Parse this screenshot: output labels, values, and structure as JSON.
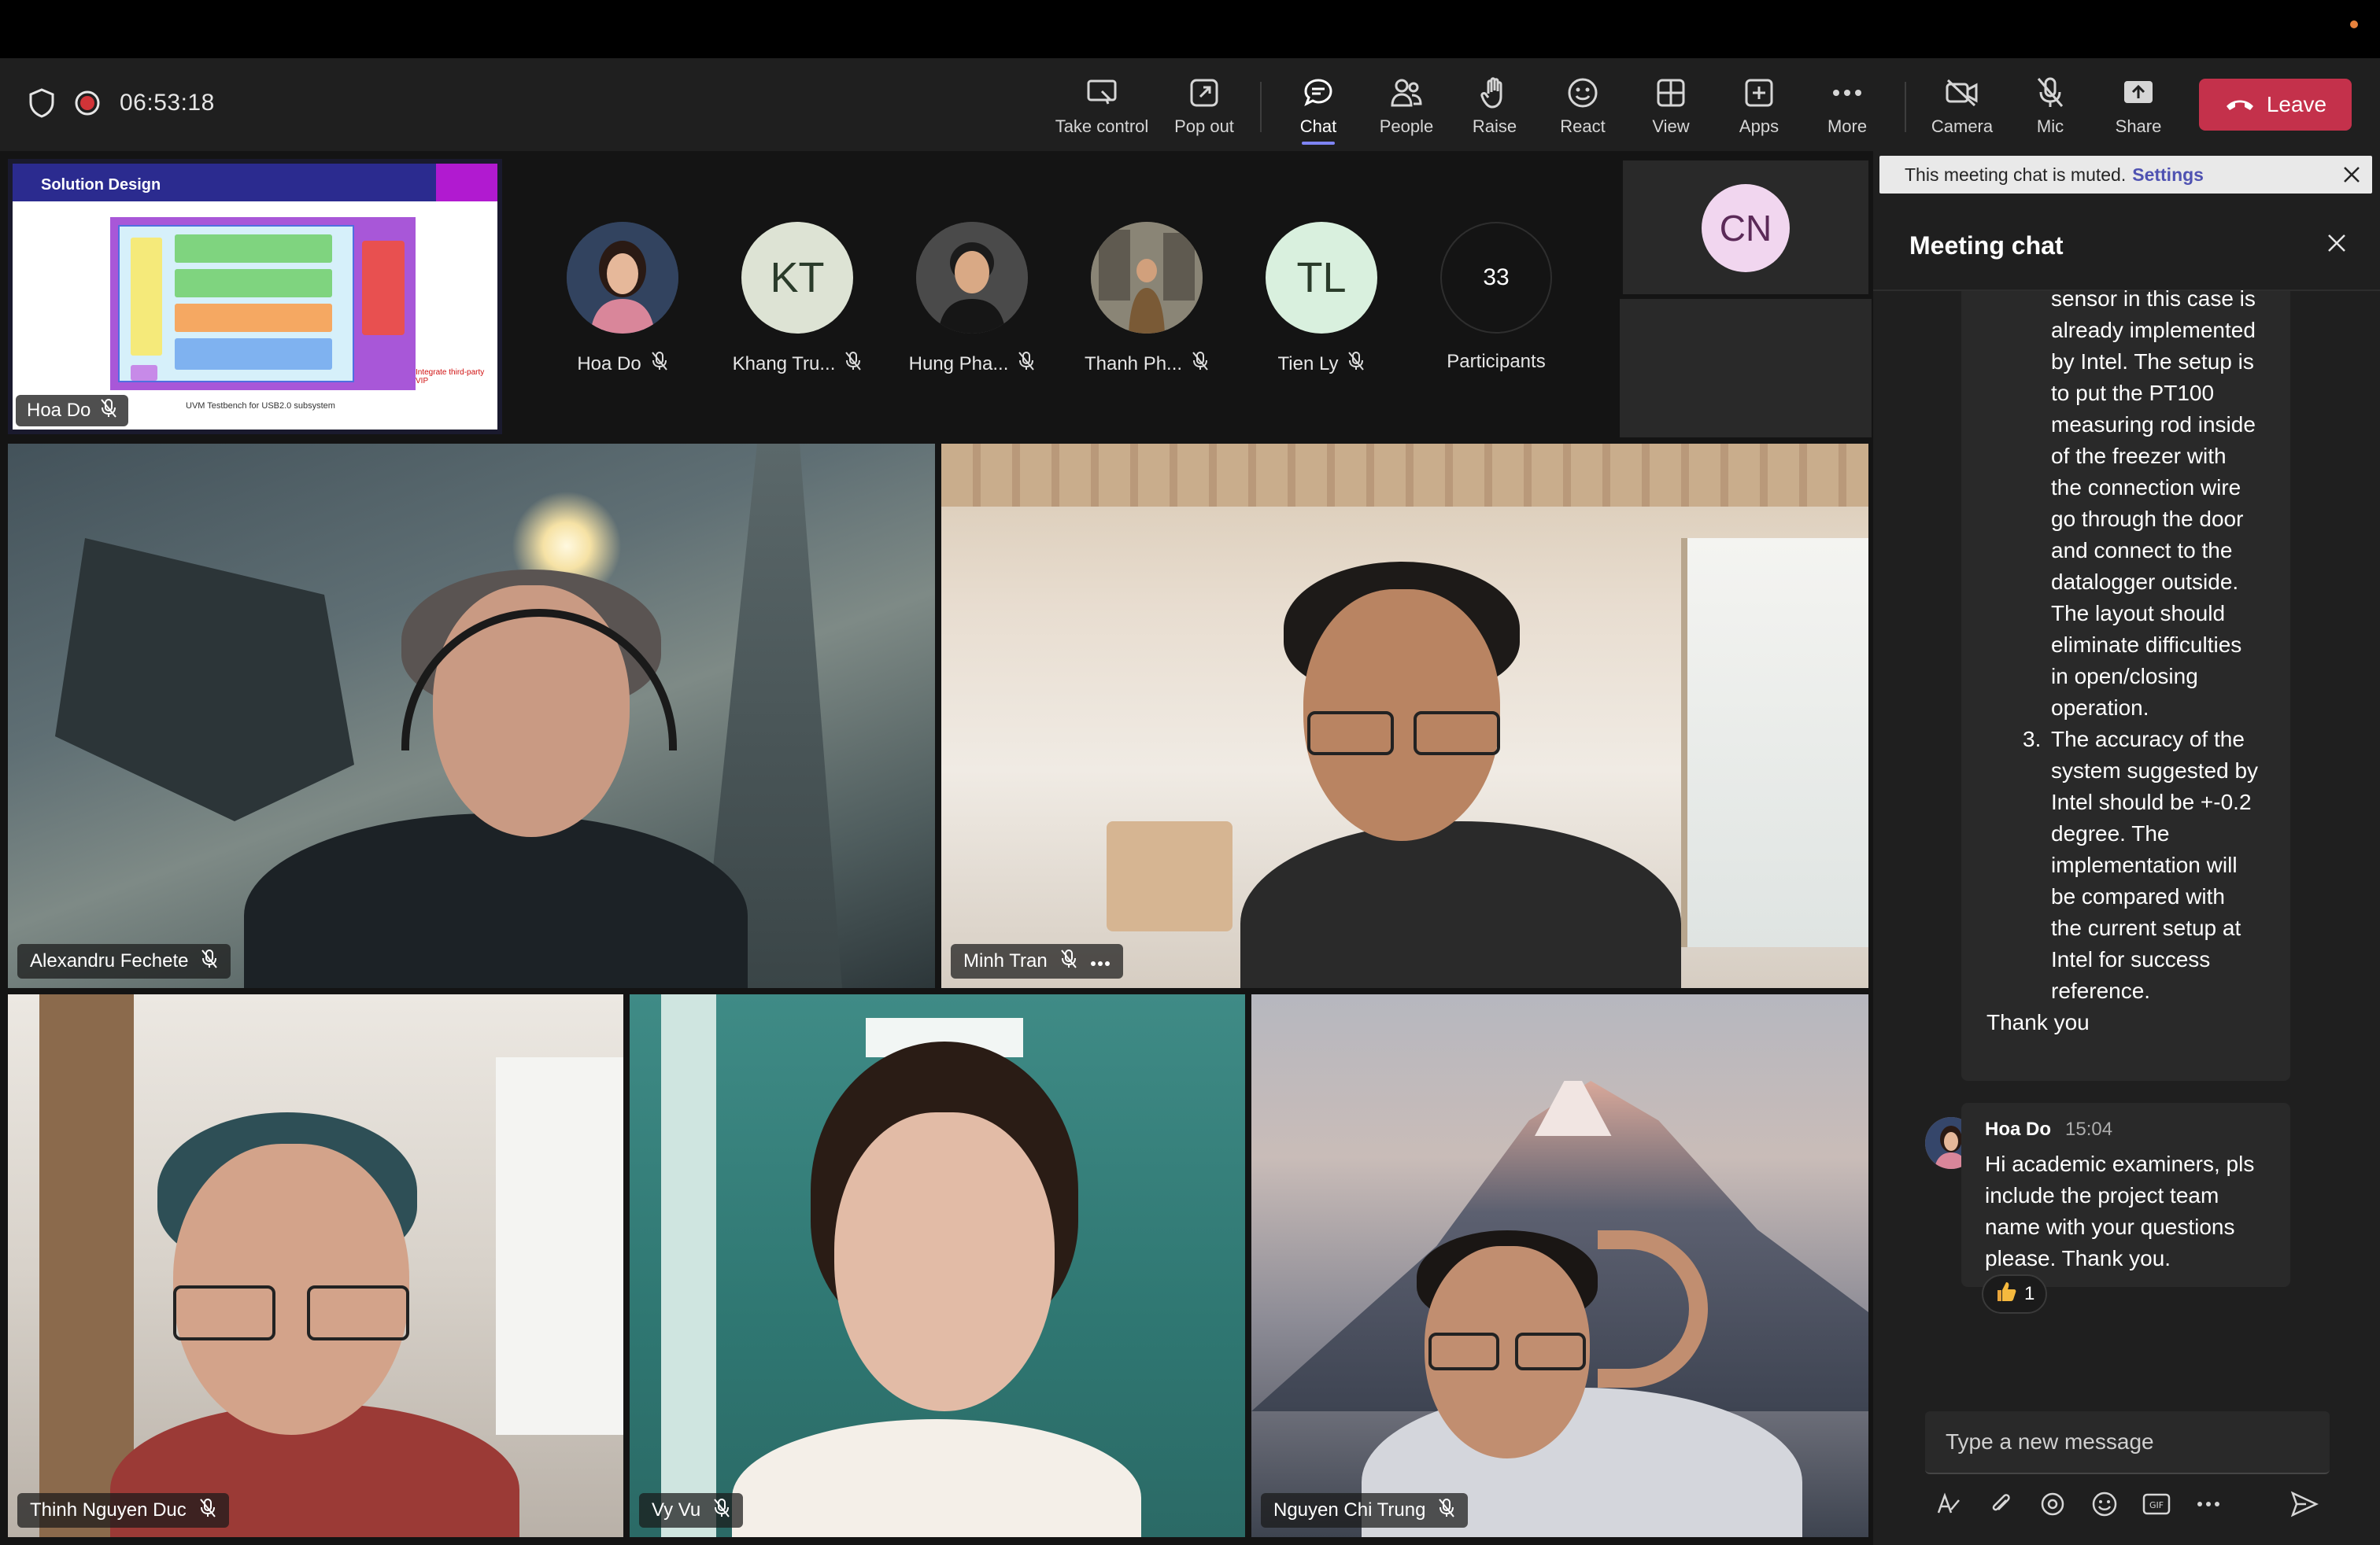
{
  "toolbar": {
    "timer": "06:53:18",
    "buttons": {
      "take_control": "Take control",
      "pop_out": "Pop out",
      "chat": "Chat",
      "people": "People",
      "raise": "Raise",
      "react": "React",
      "view": "View",
      "apps": "Apps",
      "more": "More",
      "camera": "Camera",
      "mic": "Mic",
      "share": "Share",
      "leave": "Leave"
    }
  },
  "shared_screen": {
    "presenter": "Hoa Do",
    "slide_title": "Solution Design",
    "slide_caption": "UVM Testbench for USB2.0 subsystem",
    "slide_note": "Integrate third-party VIP"
  },
  "participants_strip": {
    "people": [
      {
        "name": "Hoa Do",
        "initials": ""
      },
      {
        "name": "Khang Tru...",
        "initials": "KT"
      },
      {
        "name": "Hung Pha...",
        "initials": ""
      },
      {
        "name": "Thanh Ph...",
        "initials": ""
      },
      {
        "name": "Tien Ly",
        "initials": "TL"
      }
    ],
    "overflow_count": "33",
    "overflow_label": "Participants",
    "extra_tile_initials": "CN"
  },
  "video_tiles": [
    {
      "name": "Alexandru Fechete"
    },
    {
      "name": "Minh Tran"
    },
    {
      "name": "Thinh Nguyen Duc"
    },
    {
      "name": "Vy Vu"
    },
    {
      "name": "Nguyen Chi Trung"
    }
  ],
  "chat": {
    "muted_notice": "This meeting chat is muted.",
    "muted_link": "Settings",
    "title": "Meeting chat",
    "message1_lines": [
      "sensor in this case is",
      "already implemented",
      "by Intel. The setup is",
      "to put the PT100",
      "measuring rod inside",
      "of the freezer with",
      "the connection wire",
      "go through the door",
      "and connect to the",
      "datalogger outside.",
      "The layout should",
      "eliminate difficulties",
      "in open/closing",
      "operation.",
      "The accuracy of the",
      "system suggested by",
      "Intel should be +-0.2",
      "degree. The",
      "implementation will",
      "be compared with",
      "the current setup at",
      "Intel for success",
      "reference.",
      "Thank you"
    ],
    "list_marker": "3.",
    "message2": {
      "author": "Hoa Do",
      "time": "15:04",
      "text": "Hi academic examiners, pls include the project team name with your questions please. Thank you.",
      "reaction_count": "1"
    },
    "compose_placeholder": "Type a new message"
  },
  "colors": {
    "leave": "#c4314b",
    "accent": "#7f85f5",
    "link": "#4f52b2"
  }
}
